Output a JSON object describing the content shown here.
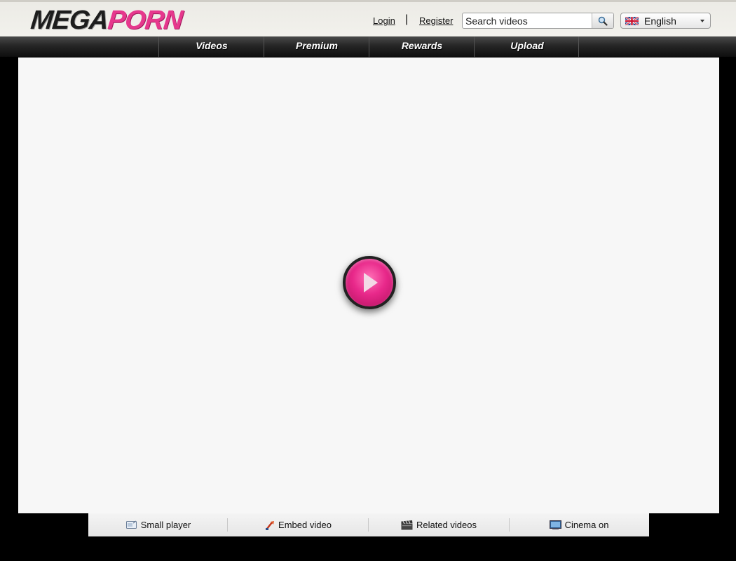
{
  "header": {
    "logo_part1": "MEGA",
    "logo_part2": "PORN",
    "login_label": "Login",
    "separator": "|",
    "register_label": "Register",
    "search": {
      "placeholder": "Search videos",
      "button_icon": "search-icon"
    },
    "language": {
      "selected": "English",
      "flag_icon": "uk-flag-icon"
    }
  },
  "nav": {
    "items": [
      {
        "label": "Videos"
      },
      {
        "label": "Premium"
      },
      {
        "label": "Rewards"
      },
      {
        "label": "Upload"
      }
    ]
  },
  "player": {
    "play_icon": "play-icon"
  },
  "toolbar": {
    "items": [
      {
        "label": "Small player",
        "icon": "small-player-icon"
      },
      {
        "label": "Embed video",
        "icon": "embed-icon"
      },
      {
        "label": "Related videos",
        "icon": "clapperboard-icon"
      },
      {
        "label": "Cinema on",
        "icon": "monitor-icon"
      }
    ]
  },
  "colors": {
    "brand_pink": "#e6388d",
    "header_bg": "#ecebe6",
    "player_bg": "#f7f7f7",
    "page_bg": "#000000"
  }
}
